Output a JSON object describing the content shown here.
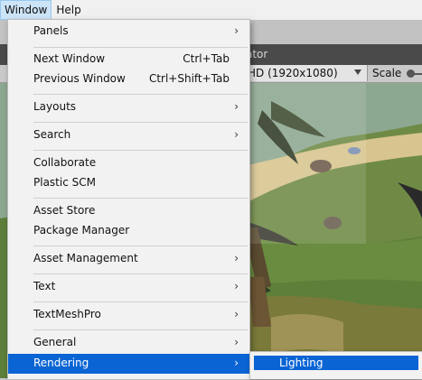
{
  "menubar": {
    "window": "Window",
    "help": "Help"
  },
  "editor": {
    "tab_fragment": "ator",
    "resolution": "HD (1920x1080)",
    "scale_label": "Scale"
  },
  "window_menu": {
    "items": [
      {
        "label": "Panels",
        "submenu": true
      },
      {
        "label": "Next Window",
        "shortcut": "Ctrl+Tab"
      },
      {
        "label": "Previous Window",
        "shortcut": "Ctrl+Shift+Tab"
      },
      {
        "label": "Layouts",
        "submenu": true
      },
      {
        "label": "Search",
        "submenu": true
      },
      {
        "label": "Collaborate"
      },
      {
        "label": "Plastic SCM"
      },
      {
        "label": "Asset Store"
      },
      {
        "label": "Package Manager"
      },
      {
        "label": "Asset Management",
        "submenu": true
      },
      {
        "label": "Text",
        "submenu": true
      },
      {
        "label": "TextMeshPro",
        "submenu": true
      },
      {
        "label": "General",
        "submenu": true
      },
      {
        "label": "Rendering",
        "submenu": true,
        "highlighted": true
      }
    ],
    "arrow_glyph": "›"
  },
  "rendering_submenu": {
    "items": [
      {
        "label": "Lighting",
        "highlighted": true
      }
    ]
  },
  "colors": {
    "highlight": "#0a64d4",
    "menu_bg": "#f2f2f2",
    "grass": "#5b7a3a",
    "sand": "#d6c08a"
  }
}
